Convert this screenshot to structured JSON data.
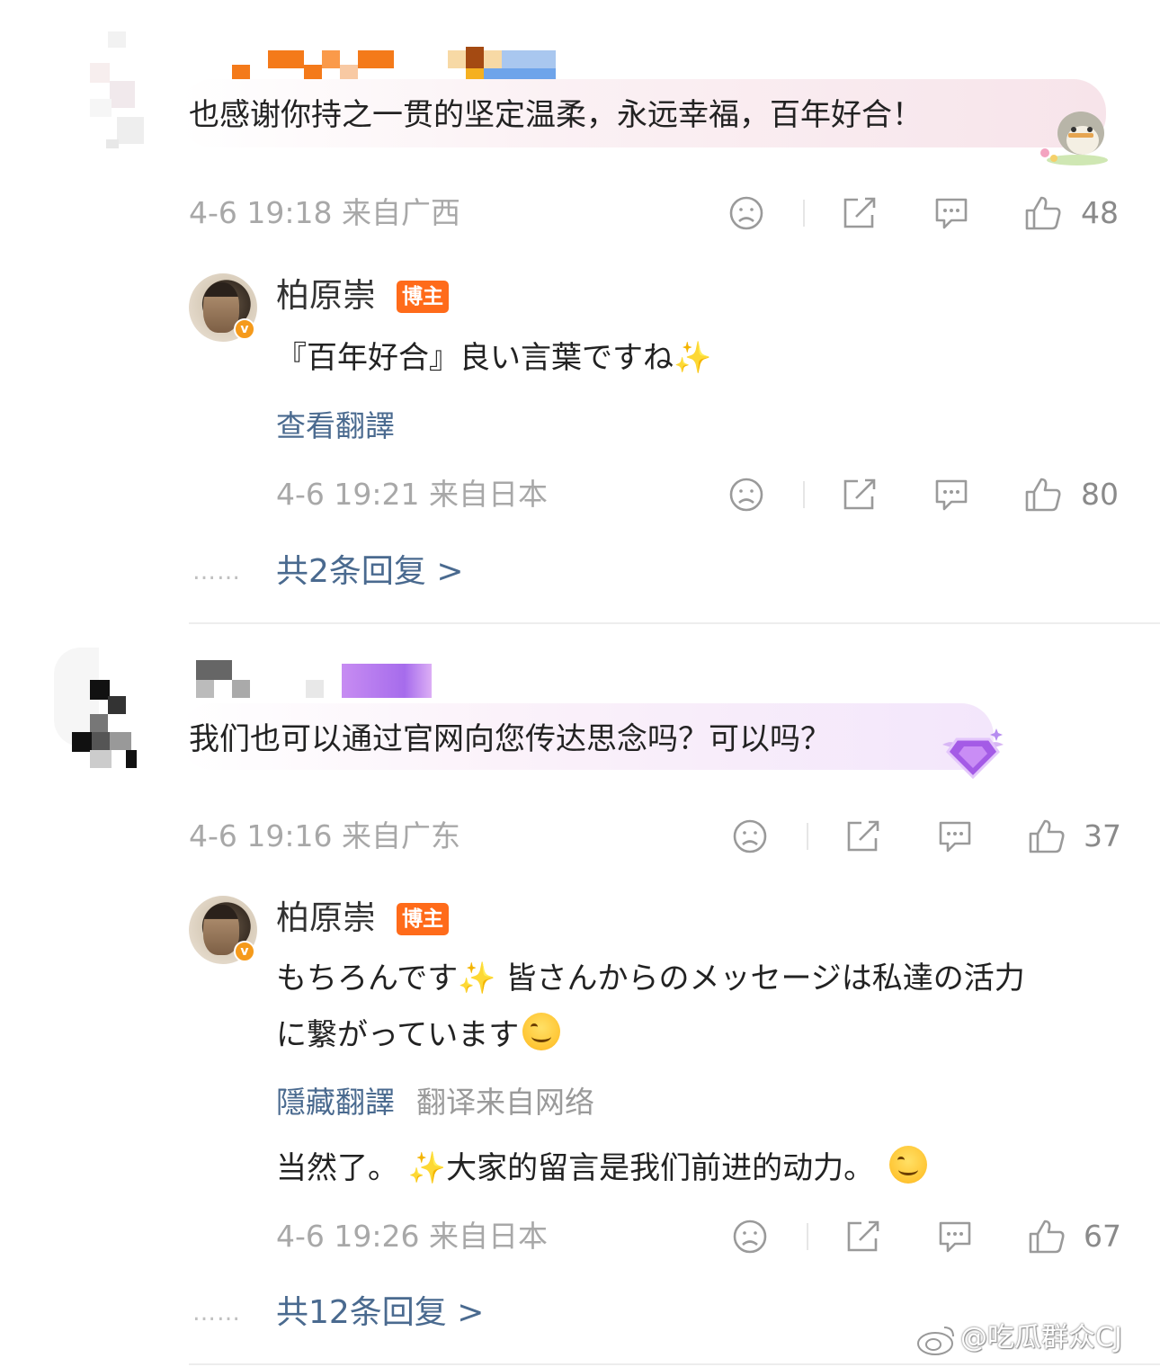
{
  "comments": [
    {
      "text": "也感谢你持之一贯的坚定温柔，永远幸福，百年好合！",
      "time": "4-6 19:18",
      "location": "来自广西",
      "likes": "48",
      "reply": {
        "name": "柏原崇",
        "badge": "博主",
        "text": "『百年好合』良い言葉ですね",
        "sparkle": "✨",
        "translate_link": "查看翻譯",
        "time": "4-6 19:21",
        "location": "来自日本",
        "likes": "80"
      },
      "more_replies": "共2条回复 >",
      "dots": "……"
    },
    {
      "text": "我们也可以通过官网向您传达思念吗？可以吗？",
      "time": "4-6 19:16",
      "location": "来自广东",
      "likes": "37",
      "reply": {
        "name": "柏原崇",
        "badge": "博主",
        "text_line1_a": "もちろんです",
        "sparkle": "✨",
        "text_line1_b": " 皆さんからのメッセージは私達の活力",
        "text_line2": "に繋がっています",
        "hide_translate": "隱藏翻譯",
        "translate_source": "翻译来自网络",
        "translation_a": "当然了。 ",
        "translation_b": "大家的留言是我们前进的动力。 ",
        "time": "4-6 19:26",
        "location": "来自日本",
        "likes": "67"
      },
      "more_replies": "共12条回复 >",
      "dots": "……"
    }
  ],
  "watermark": "@吃瓜群众CJ",
  "icons": [
    "dislike-icon",
    "share-icon",
    "comment-icon",
    "like-icon"
  ],
  "colors": {
    "link": "#4a6a8f",
    "badge": "#ff6b1a",
    "meta": "#a8a8a8"
  }
}
